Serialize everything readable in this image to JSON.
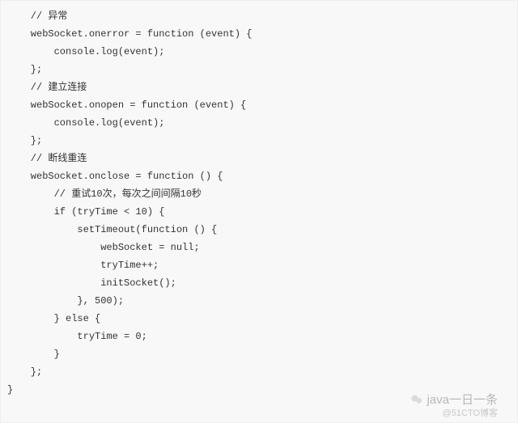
{
  "code": {
    "lines": [
      "    // 异常",
      "    webSocket.onerror = function (event) {",
      "        console.log(event);",
      "    };",
      "",
      "    // 建立连接",
      "    webSocket.onopen = function (event) {",
      "        console.log(event);",
      "    };",
      "",
      "    // 断线重连",
      "    webSocket.onclose = function () {",
      "        // 重试10次，每次之间间隔10秒",
      "        if (tryTime < 10) {",
      "            setTimeout(function () {",
      "                webSocket = null;",
      "                tryTime++;",
      "                initSocket();",
      "            }, 500);",
      "        } else {",
      "            tryTime = 0;",
      "        }",
      "    };",
      "",
      "}"
    ]
  },
  "watermark": {
    "main": "java一日一条",
    "sub": "@51CTO博客"
  }
}
